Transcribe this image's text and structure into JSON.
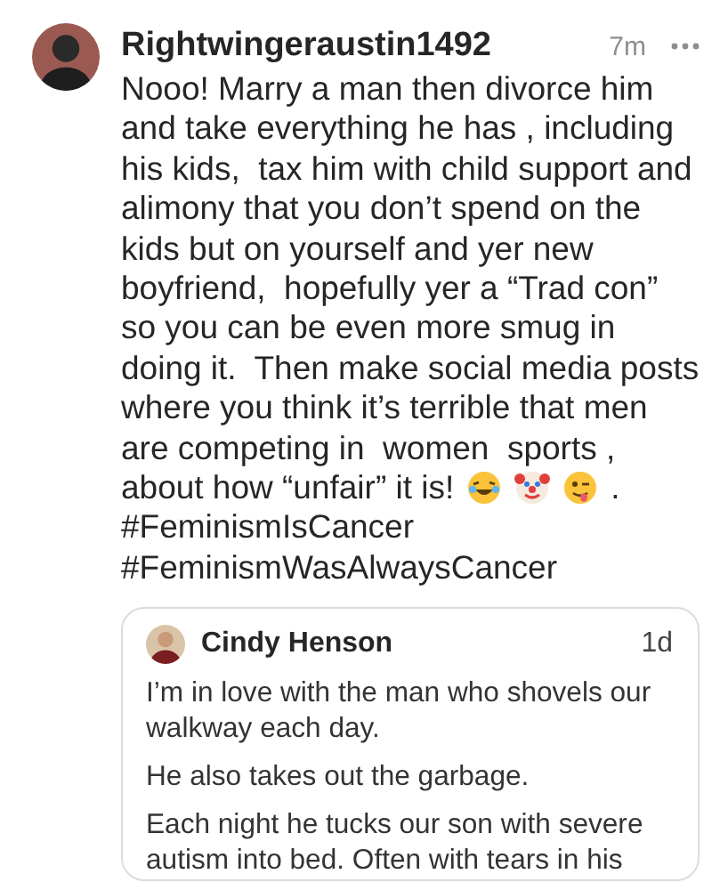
{
  "post": {
    "author": "Rightwingeraustin1492",
    "time": "7m",
    "text": "Nooo! Marry a man then divorce him and take everything he has , including his kids,  tax him with child support and alimony that you don’t spend on the kids but on yourself and yer new boyfriend,  hopefully yer a “Trad con” so you can be even more smug in doing it.  Then make social media posts where you think it’s terrible that men are competing in  women  sports ,",
    "text_tail": "about how “unfair” it is!",
    "emojis": [
      {
        "kind": "laughing"
      },
      {
        "kind": "clown"
      },
      {
        "kind": "winking"
      }
    ],
    "text_end": ".",
    "hashtags": [
      "#FeminismIsCancer",
      "#FeminismWasAlwaysCancer"
    ]
  },
  "quoted_post": {
    "author": "Cindy Henson",
    "time": "1d",
    "paragraphs": [
      "I’m in love with the man who shovels our walkway each day.",
      "He also takes out the garbage.",
      "Each night he tucks our son with severe autism into bed. Often with tears in his"
    ]
  }
}
